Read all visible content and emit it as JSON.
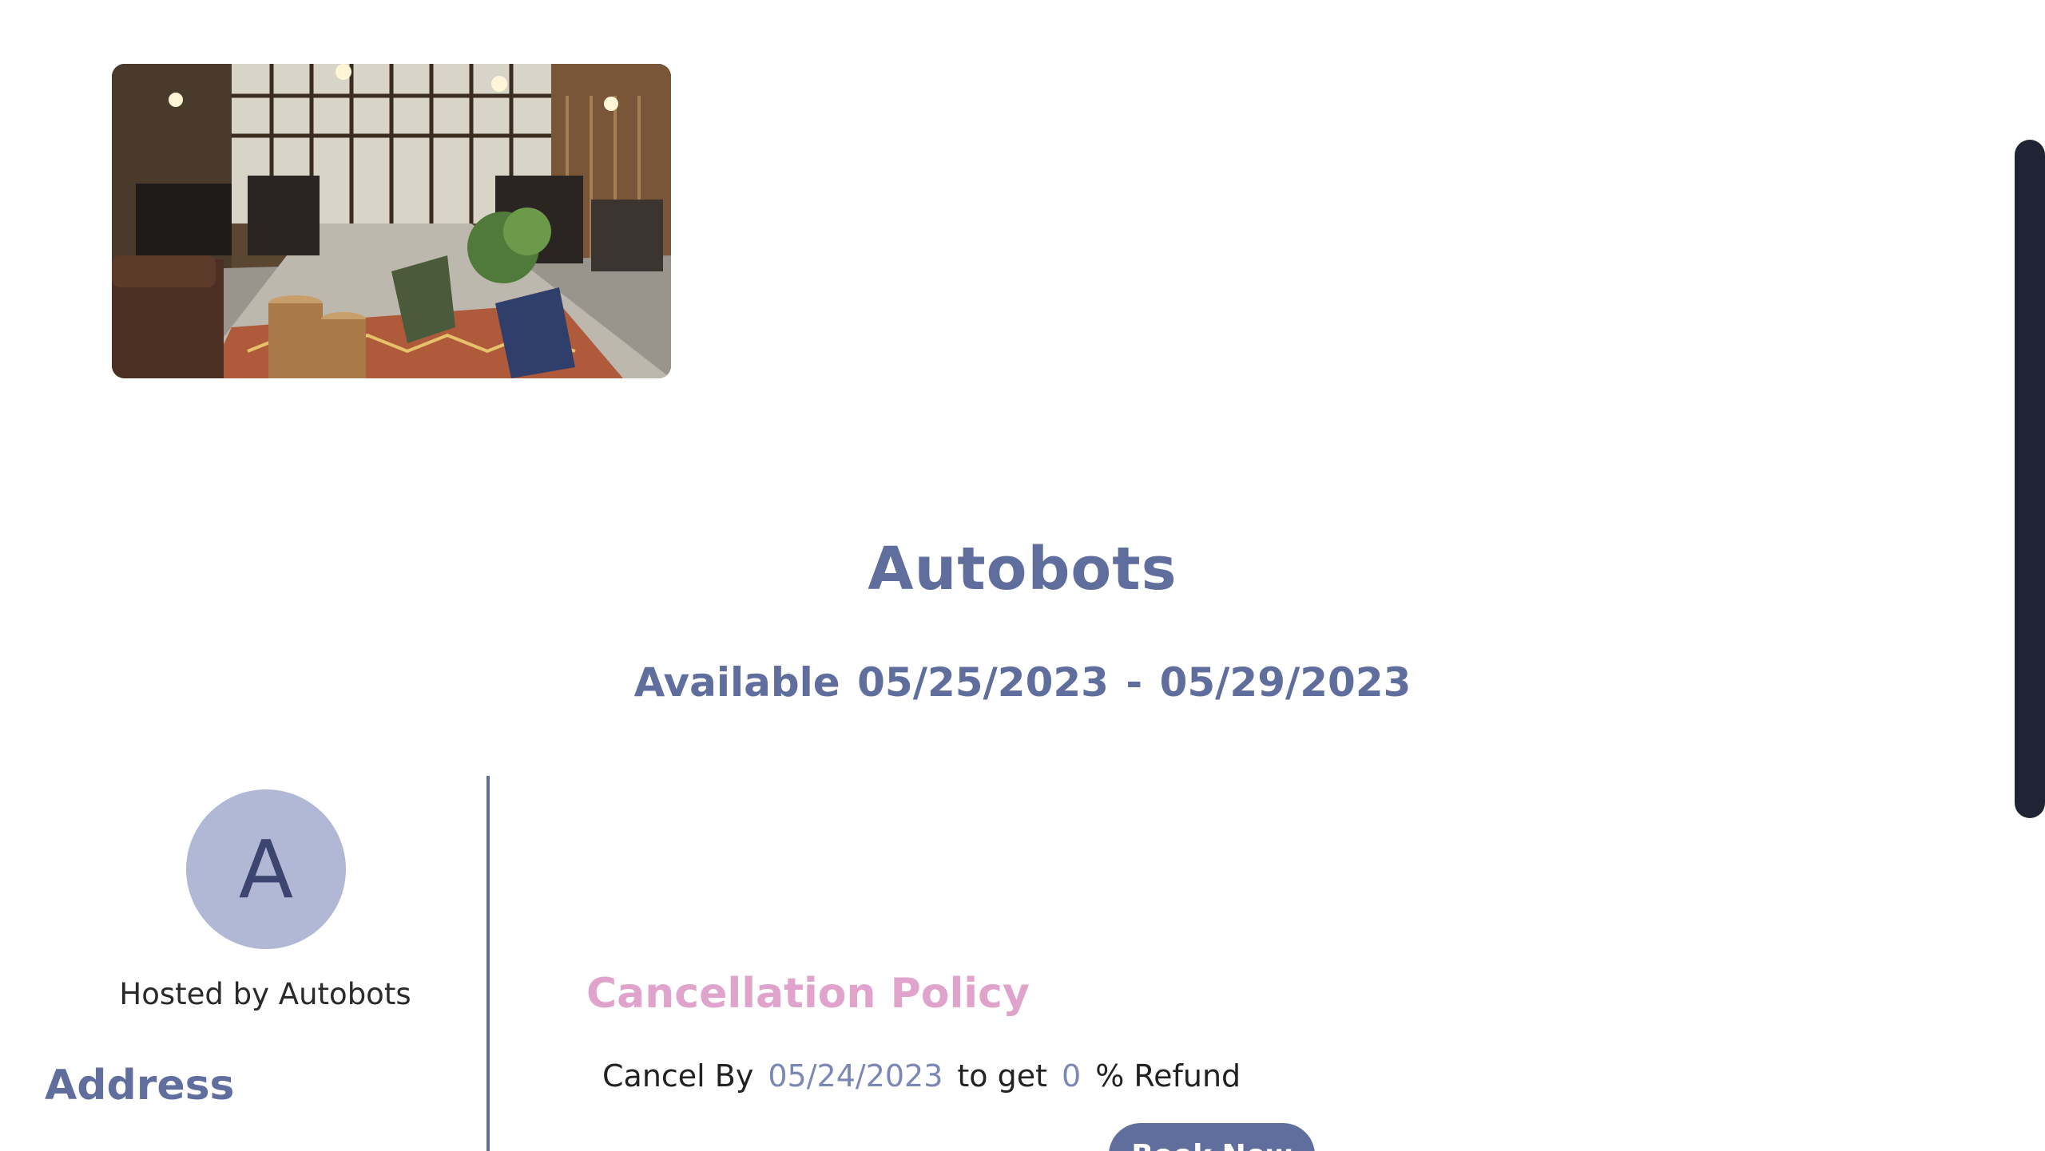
{
  "listing": {
    "image_alt": "store interior photo",
    "title": "Autobots",
    "availability_prefix": "Available",
    "start_date": "05/25/2023",
    "date_separator": "-",
    "end_date": "05/29/2023"
  },
  "host": {
    "avatar_initial": "A",
    "label": "Hosted by Autobots"
  },
  "address": {
    "heading": "Address"
  },
  "cancellation": {
    "heading": "Cancellation Policy",
    "cancel_by_label": "Cancel By",
    "cancel_by_date": "05/24/2023",
    "to_get_label": "to get",
    "refund_value": "0",
    "refund_suffix": "% Refund"
  },
  "action": {
    "button_label": "Book Now"
  },
  "colors": {
    "accent": "#5f6e9c",
    "policy_heading": "#e0a3cb",
    "avatar_bg": "#b0b8d6",
    "scrollbar_thumb": "#1f2434"
  }
}
